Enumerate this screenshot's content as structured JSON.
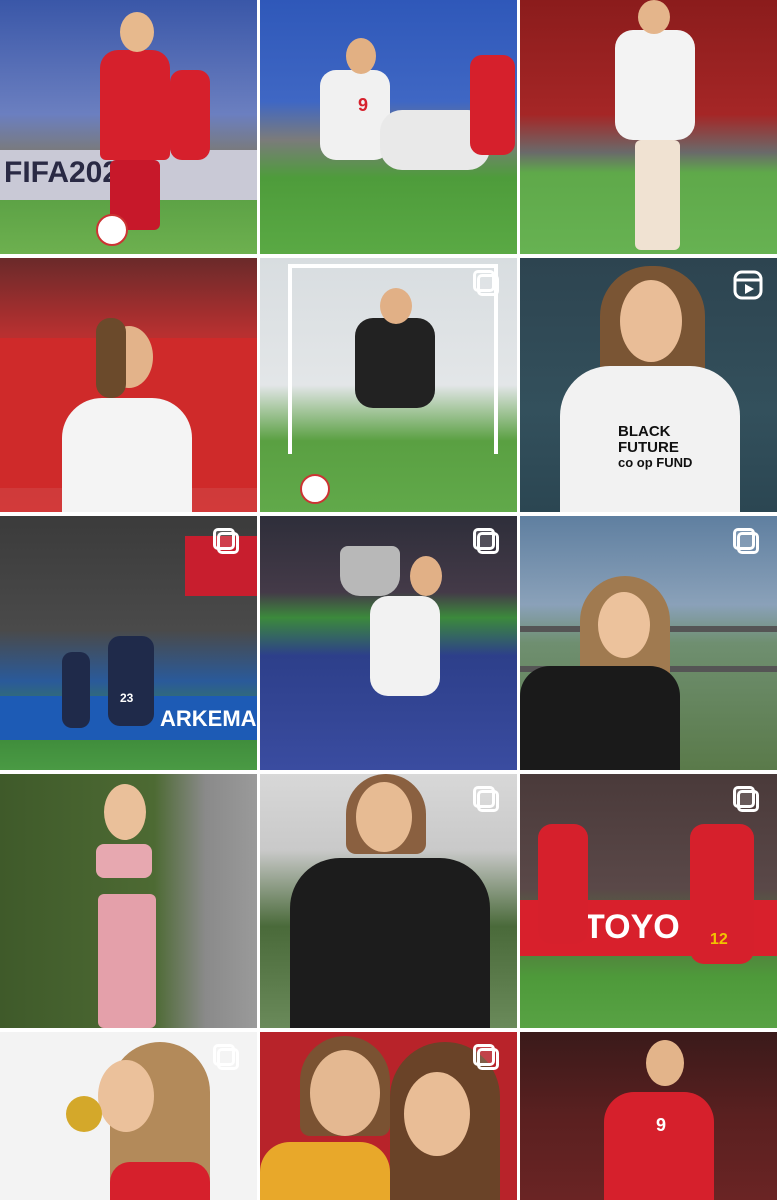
{
  "grid": {
    "columns": 3,
    "tiles": [
      {
        "name": "post-1",
        "badge": "none"
      },
      {
        "name": "post-2",
        "badge": "none"
      },
      {
        "name": "post-3",
        "badge": "none"
      },
      {
        "name": "post-4",
        "badge": "none"
      },
      {
        "name": "post-5",
        "badge": "carousel-icon"
      },
      {
        "name": "post-6",
        "badge": "reel-icon",
        "shirt_text": "BLACK FUTURE co·op FUND"
      },
      {
        "name": "post-7",
        "badge": "carousel-icon",
        "banner_text": "ARKEMA",
        "jersey_number": "23"
      },
      {
        "name": "post-8",
        "badge": "carousel-icon"
      },
      {
        "name": "post-9",
        "badge": "carousel-icon"
      },
      {
        "name": "post-10",
        "badge": "none"
      },
      {
        "name": "post-11",
        "badge": "carousel-icon"
      },
      {
        "name": "post-12",
        "badge": "carousel-icon",
        "banner_text": "TOYO",
        "jersey_number": "12"
      },
      {
        "name": "post-13",
        "badge": "carousel-icon"
      },
      {
        "name": "post-14",
        "badge": "carousel-icon"
      },
      {
        "name": "post-15",
        "badge": "none",
        "jersey_number": "9"
      }
    ],
    "texts": {
      "t1_board": "FIFA202",
      "t2_number": "9",
      "t6_shirt_line1": "BLACK",
      "t6_shirt_line2": "FUTURE",
      "t6_shirt_line3": "co op FUND",
      "t7_banner": "ARKEMA",
      "t7_number": "23",
      "t12_banner": "TOYO",
      "t12_number": "12",
      "t15_number": "9"
    }
  },
  "colors": {
    "canada_red": "#d6202c",
    "grass": "#4f9a3a",
    "white_kit": "#f2f2f2",
    "psg_navy": "#1f2a4a"
  }
}
